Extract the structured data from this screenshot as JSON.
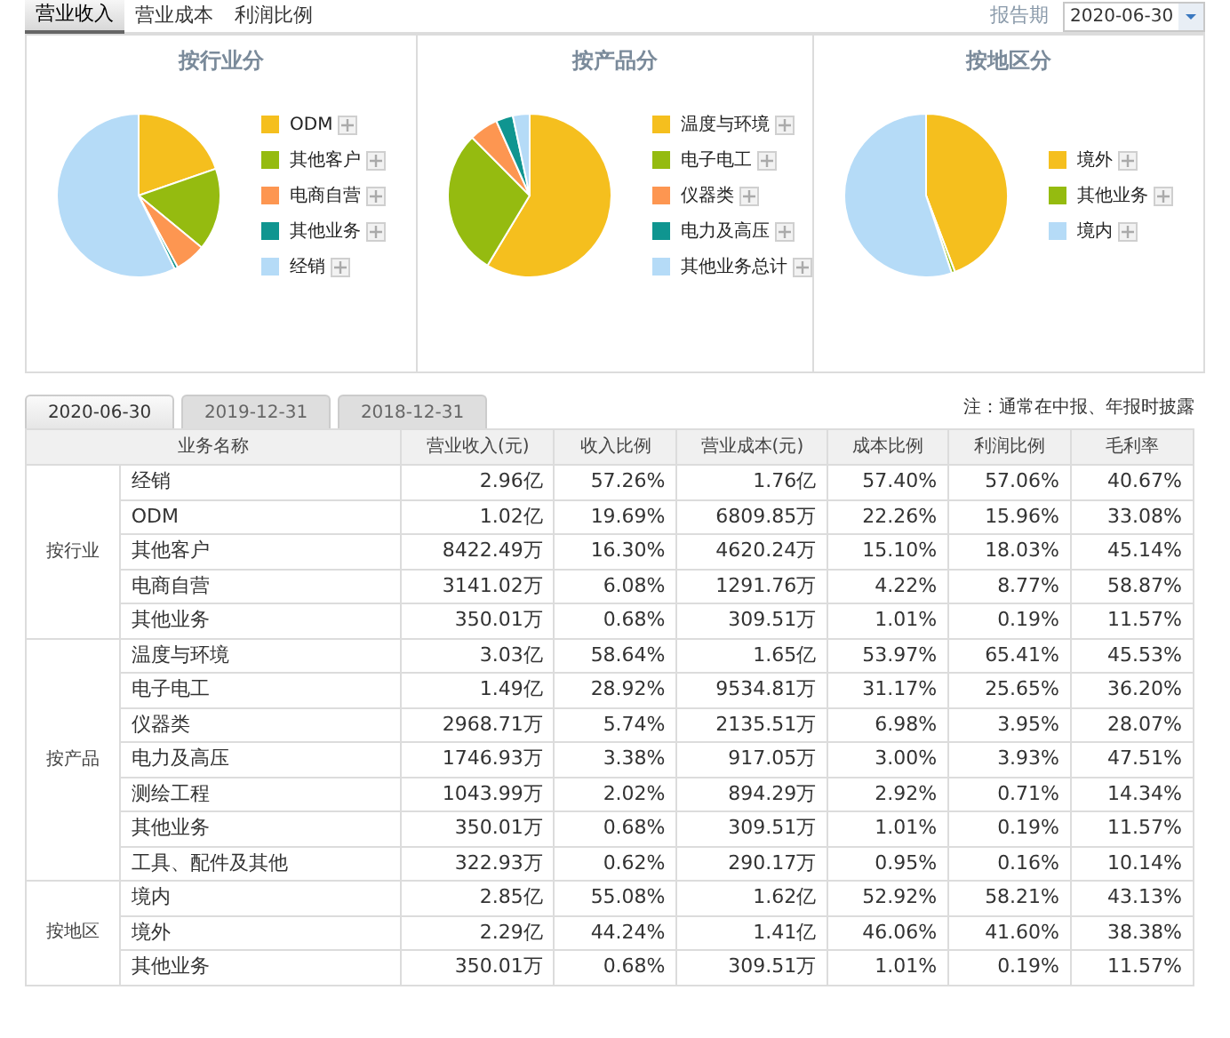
{
  "top_tabs": [
    {
      "label": "营业收入",
      "selected": true
    },
    {
      "label": "营业成本",
      "selected": false
    },
    {
      "label": "利润比例",
      "selected": false
    }
  ],
  "report_period": {
    "label": "报告期",
    "value": "2020-06-30"
  },
  "pie_panels": [
    {
      "title": "按行业分",
      "legend": [
        {
          "label": "ODM",
          "color": "#f5bf1e"
        },
        {
          "label": "其他客户",
          "color": "#95bb10"
        },
        {
          "label": "电商自营",
          "color": "#fd9651"
        },
        {
          "label": "其他业务",
          "color": "#0f9590"
        },
        {
          "label": "经销",
          "color": "#b5dbf7"
        }
      ]
    },
    {
      "title": "按产品分",
      "legend": [
        {
          "label": "温度与环境",
          "color": "#f5bf1e"
        },
        {
          "label": "电子电工",
          "color": "#95bb10"
        },
        {
          "label": "仪器类",
          "color": "#fd9651"
        },
        {
          "label": "电力及高压",
          "color": "#0f9590"
        },
        {
          "label": "其他业务总计",
          "color": "#b5dbf7"
        }
      ]
    },
    {
      "title": "按地区分",
      "legend": [
        {
          "label": "境外",
          "color": "#f5bf1e"
        },
        {
          "label": "其他业务",
          "color": "#95bb10"
        },
        {
          "label": "境内",
          "color": "#b5dbf7"
        }
      ]
    }
  ],
  "date_tabs": [
    {
      "label": "2020-06-30",
      "selected": true
    },
    {
      "label": "2019-12-31",
      "selected": false
    },
    {
      "label": "2018-12-31",
      "selected": false
    }
  ],
  "note": "注：通常在中报、年报时披露",
  "table": {
    "columns": [
      "业务名称",
      "营业收入(元)",
      "收入比例",
      "营业成本(元)",
      "成本比例",
      "利润比例",
      "毛利率"
    ],
    "groups": [
      {
        "name": "按行业",
        "rows": [
          [
            "经销",
            "2.96亿",
            "57.26%",
            "1.76亿",
            "57.40%",
            "57.06%",
            "40.67%"
          ],
          [
            "ODM",
            "1.02亿",
            "19.69%",
            "6809.85万",
            "22.26%",
            "15.96%",
            "33.08%"
          ],
          [
            "其他客户",
            "8422.49万",
            "16.30%",
            "4620.24万",
            "15.10%",
            "18.03%",
            "45.14%"
          ],
          [
            "电商自营",
            "3141.02万",
            "6.08%",
            "1291.76万",
            "4.22%",
            "8.77%",
            "58.87%"
          ],
          [
            "其他业务",
            "350.01万",
            "0.68%",
            "309.51万",
            "1.01%",
            "0.19%",
            "11.57%"
          ]
        ]
      },
      {
        "name": "按产品",
        "rows": [
          [
            "温度与环境",
            "3.03亿",
            "58.64%",
            "1.65亿",
            "53.97%",
            "65.41%",
            "45.53%"
          ],
          [
            "电子电工",
            "1.49亿",
            "28.92%",
            "9534.81万",
            "31.17%",
            "25.65%",
            "36.20%"
          ],
          [
            "仪器类",
            "2968.71万",
            "5.74%",
            "2135.51万",
            "6.98%",
            "3.95%",
            "28.07%"
          ],
          [
            "电力及高压",
            "1746.93万",
            "3.38%",
            "917.05万",
            "3.00%",
            "3.93%",
            "47.51%"
          ],
          [
            "测绘工程",
            "1043.99万",
            "2.02%",
            "894.29万",
            "2.92%",
            "0.71%",
            "14.34%"
          ],
          [
            "其他业务",
            "350.01万",
            "0.68%",
            "309.51万",
            "1.01%",
            "0.19%",
            "11.57%"
          ],
          [
            "工具、配件及其他",
            "322.93万",
            "0.62%",
            "290.17万",
            "0.95%",
            "0.16%",
            "10.14%"
          ]
        ]
      },
      {
        "name": "按地区",
        "rows": [
          [
            "境内",
            "2.85亿",
            "55.08%",
            "1.62亿",
            "52.92%",
            "58.21%",
            "43.13%"
          ],
          [
            "境外",
            "2.29亿",
            "44.24%",
            "1.41亿",
            "46.06%",
            "41.60%",
            "38.38%"
          ],
          [
            "其他业务",
            "350.01万",
            "0.68%",
            "309.51万",
            "1.01%",
            "0.19%",
            "11.57%"
          ]
        ]
      }
    ]
  }
}
